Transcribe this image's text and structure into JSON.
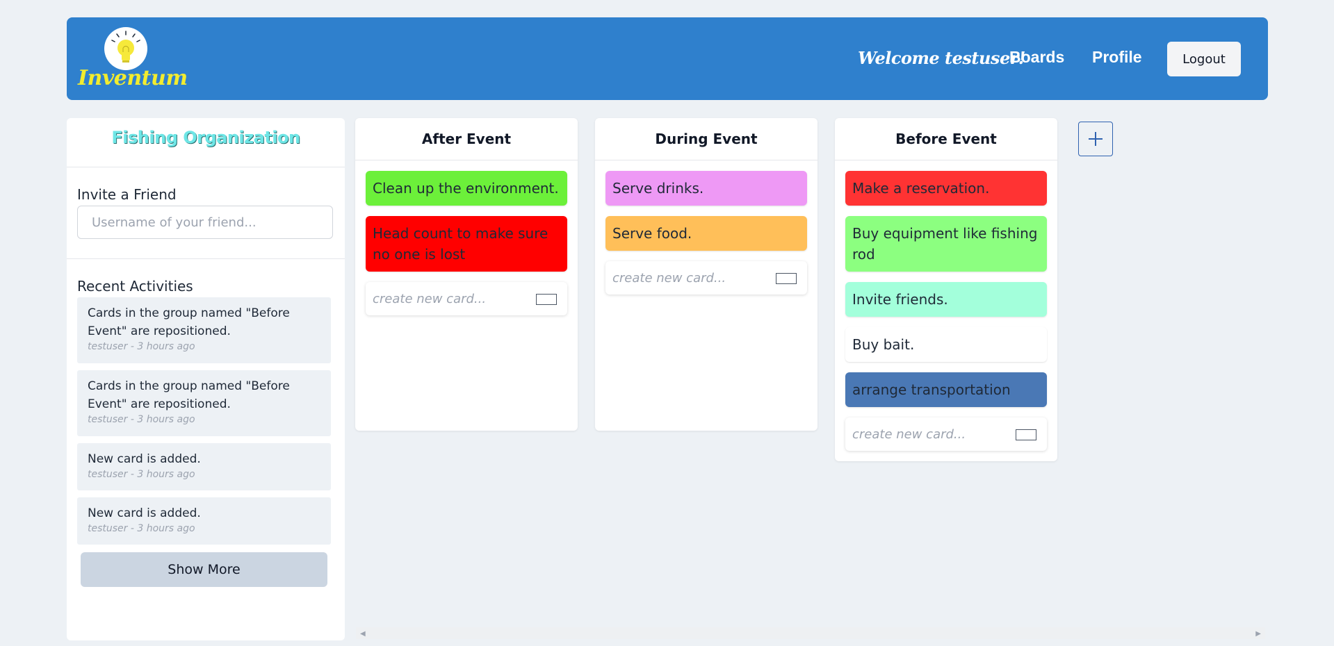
{
  "header": {
    "logo_text": "Inventum",
    "welcome": "Welcome testuser!",
    "nav": [
      "Boards",
      "Profile"
    ],
    "logout_label": "Logout",
    "bg_color": "#2f80cd"
  },
  "sidebar": {
    "board_name": "Fishing Organization",
    "invite_label": "Invite a Friend",
    "invite_placeholder": "Username of your friend...",
    "activities_label": "Recent Activities",
    "activities": [
      {
        "text": "Cards in the group named \"Before Event\" are repositioned.",
        "meta": "testuser - 3 hours ago"
      },
      {
        "text": "Cards in the group named \"Before Event\" are repositioned.",
        "meta": "testuser - 3 hours ago"
      },
      {
        "text": "New card is added.",
        "meta": "testuser - 3 hours ago"
      },
      {
        "text": "New card is added.",
        "meta": "testuser - 3 hours ago"
      }
    ],
    "show_more_label": "Show More"
  },
  "columns": [
    {
      "title": "After Event",
      "cards": [
        {
          "text": "Clean up the environment.",
          "color": "#6cf03a"
        },
        {
          "text": "Head count to make sure no one is lost",
          "color": "#ff0000"
        }
      ],
      "new_card_placeholder": "create new card..."
    },
    {
      "title": "During Event",
      "cards": [
        {
          "text": "Serve drinks.",
          "color": "#ee99f5"
        },
        {
          "text": "Serve food.",
          "color": "#ffbf59"
        }
      ],
      "new_card_placeholder": "create new card..."
    },
    {
      "title": "Before Event",
      "cards": [
        {
          "text": "Make a reservation.",
          "color": "#ff3333"
        },
        {
          "text": "Buy equipment like fishing rod",
          "color": "#8cff80"
        },
        {
          "text": "Invite friends.",
          "color": "#a3ffdb"
        },
        {
          "text": "Buy bait.",
          "color": "#ffffff"
        },
        {
          "text": "arrange transportation",
          "color": "#4a78b5"
        }
      ],
      "new_card_placeholder": "create new card..."
    }
  ],
  "add_column_icon": "plus-icon"
}
